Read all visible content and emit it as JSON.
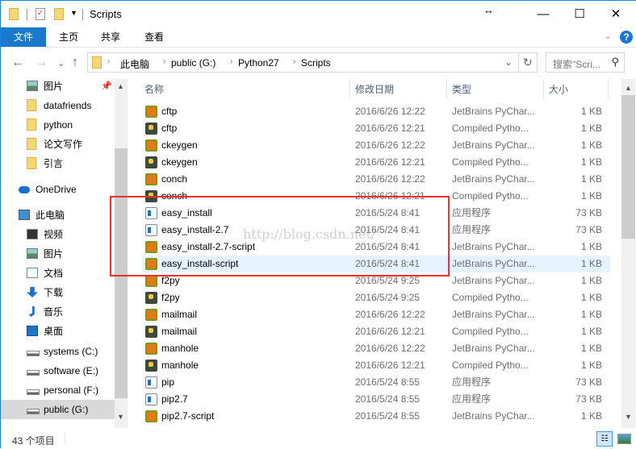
{
  "window": {
    "title": "Scripts",
    "minimize": "—",
    "maximize": "☐",
    "close": "✕",
    "resize_cursor": "↔"
  },
  "ribbon": {
    "tabs": [
      "文件",
      "主页",
      "共享",
      "查看"
    ],
    "expand": "⌄",
    "help": "?"
  },
  "nav": {
    "back": "←",
    "forward": "→",
    "recent": "⌄",
    "up": "↑",
    "refresh": "↻",
    "dropdown": "⌄"
  },
  "breadcrumb": [
    "此电脑",
    "public (G:)",
    "Python27",
    "Scripts"
  ],
  "search": {
    "placeholder": "搜索\"Scri...",
    "icon": "⚲"
  },
  "sidebar": {
    "items": [
      {
        "label": "图片",
        "icon": "pictures-icon",
        "pinned": true
      },
      {
        "label": "datafriends",
        "icon": "folder-icon"
      },
      {
        "label": "python",
        "icon": "folder-icon"
      },
      {
        "label": "论文写作",
        "icon": "folder-icon"
      },
      {
        "label": "引言",
        "icon": "folder-icon"
      },
      {
        "label": "OneDrive",
        "icon": "cloud-icon"
      },
      {
        "label": "此电脑",
        "icon": "computer-icon"
      },
      {
        "label": "视频",
        "icon": "video-icon"
      },
      {
        "label": "图片",
        "icon": "pictures-icon"
      },
      {
        "label": "文档",
        "icon": "documents-icon"
      },
      {
        "label": "下载",
        "icon": "download-icon"
      },
      {
        "label": "音乐",
        "icon": "music-icon"
      },
      {
        "label": "桌面",
        "icon": "desktop-icon"
      },
      {
        "label": "systems (C:)",
        "icon": "drive-icon"
      },
      {
        "label": "software (E:)",
        "icon": "drive-icon"
      },
      {
        "label": "personal (F:)",
        "icon": "drive-icon"
      },
      {
        "label": "public (G:)",
        "icon": "drive-icon",
        "selected": true
      }
    ]
  },
  "columns": [
    "名称",
    "修改日期",
    "类型",
    "大小"
  ],
  "files": [
    {
      "name": "cftp",
      "date": "2016/6/26 12:22",
      "type": "JetBrains PyChar...",
      "size": "1 KB",
      "icon": "pc"
    },
    {
      "name": "cftp",
      "date": "2016/6/26 12:21",
      "type": "Compiled Pytho...",
      "size": "1 KB",
      "icon": "pyc"
    },
    {
      "name": "ckeygen",
      "date": "2016/6/26 12:22",
      "type": "JetBrains PyChar...",
      "size": "1 KB",
      "icon": "pc"
    },
    {
      "name": "ckeygen",
      "date": "2016/6/26 12:21",
      "type": "Compiled Pytho...",
      "size": "1 KB",
      "icon": "pyc"
    },
    {
      "name": "conch",
      "date": "2016/6/26 12:22",
      "type": "JetBrains PyChar...",
      "size": "1 KB",
      "icon": "pc"
    },
    {
      "name": "conch",
      "date": "2016/6/26 12:21",
      "type": "Compiled Pytho...",
      "size": "1 KB",
      "icon": "pyc"
    },
    {
      "name": "easy_install",
      "date": "2016/5/24 8:41",
      "type": "应用程序",
      "size": "73 KB",
      "icon": "exe"
    },
    {
      "name": "easy_install-2.7",
      "date": "2016/5/24 8:41",
      "type": "应用程序",
      "size": "73 KB",
      "icon": "exe"
    },
    {
      "name": "easy_install-2.7-script",
      "date": "2016/5/24 8:41",
      "type": "JetBrains PyChar...",
      "size": "1 KB",
      "icon": "pc"
    },
    {
      "name": "easy_install-script",
      "date": "2016/5/24 8:41",
      "type": "JetBrains PyChar...",
      "size": "1 KB",
      "icon": "pc",
      "selected": true
    },
    {
      "name": "f2py",
      "date": "2016/5/24 9:25",
      "type": "JetBrains PyChar...",
      "size": "1 KB",
      "icon": "pc"
    },
    {
      "name": "f2py",
      "date": "2016/5/24 9:25",
      "type": "Compiled Pytho...",
      "size": "1 KB",
      "icon": "pyc"
    },
    {
      "name": "mailmail",
      "date": "2016/6/26 12:22",
      "type": "JetBrains PyChar...",
      "size": "1 KB",
      "icon": "pc"
    },
    {
      "name": "mailmail",
      "date": "2016/6/26 12:21",
      "type": "Compiled Pytho...",
      "size": "1 KB",
      "icon": "pyc"
    },
    {
      "name": "manhole",
      "date": "2016/6/26 12:22",
      "type": "JetBrains PyChar...",
      "size": "1 KB",
      "icon": "pc"
    },
    {
      "name": "manhole",
      "date": "2016/6/26 12:21",
      "type": "Compiled Pytho...",
      "size": "1 KB",
      "icon": "pyc"
    },
    {
      "name": "pip",
      "date": "2016/5/24 8:55",
      "type": "应用程序",
      "size": "73 KB",
      "icon": "exe"
    },
    {
      "name": "pip2.7",
      "date": "2016/5/24 8:55",
      "type": "应用程序",
      "size": "73 KB",
      "icon": "exe"
    },
    {
      "name": "pip2.7-script",
      "date": "2016/5/24 8:55",
      "type": "JetBrains PyChar...",
      "size": "1 KB",
      "icon": "pc"
    }
  ],
  "status": {
    "count": "43 个项目"
  },
  "watermark": "http://blog.csdn.net/",
  "colors": {
    "accent": "#1979ca",
    "highlight": "#f03030",
    "selection": "#e5f3ff"
  }
}
